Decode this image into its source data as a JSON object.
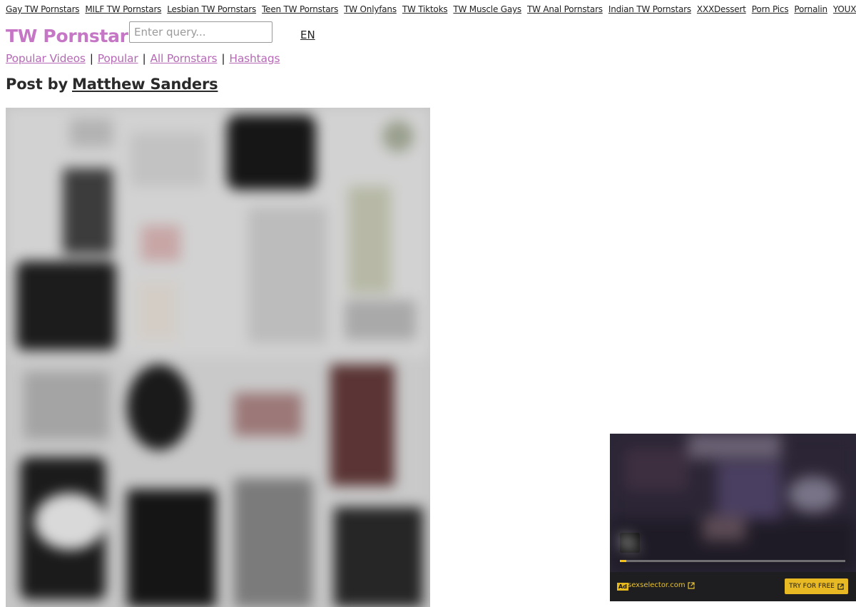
{
  "top_links": [
    "Gay TW Pornstars",
    "MILF TW Pornstars",
    "Lesbian TW Pornstars",
    "Teen TW Pornstars",
    "TW Onlyfans",
    "TW Tiktoks",
    "TW Muscle Gays",
    "TW Anal Pornstars",
    "Indian TW Pornstars",
    "XXXDessert",
    "Porn Pics",
    "Pornalin",
    "YOUX"
  ],
  "header": {
    "logo": "TW Pornstars",
    "search_placeholder": "Enter query...",
    "language": "EN"
  },
  "subnav": {
    "items": [
      "Popular Videos",
      "Popular",
      "All Pornstars",
      "Hashtags"
    ],
    "separator": "|"
  },
  "post": {
    "prefix": "Post by",
    "author": "Matthew Sanders"
  },
  "ad": {
    "label": "Ad",
    "domain": "sexselector.com",
    "cta": "TRY FOR FREE",
    "progress_fraction": 0.03
  },
  "colors": {
    "brand": "#c576c5",
    "link_accent": "#b56ab5",
    "ad_accent": "#e8b922"
  },
  "icons": {
    "mute": "mute-icon",
    "external_link": "external-link-icon"
  }
}
